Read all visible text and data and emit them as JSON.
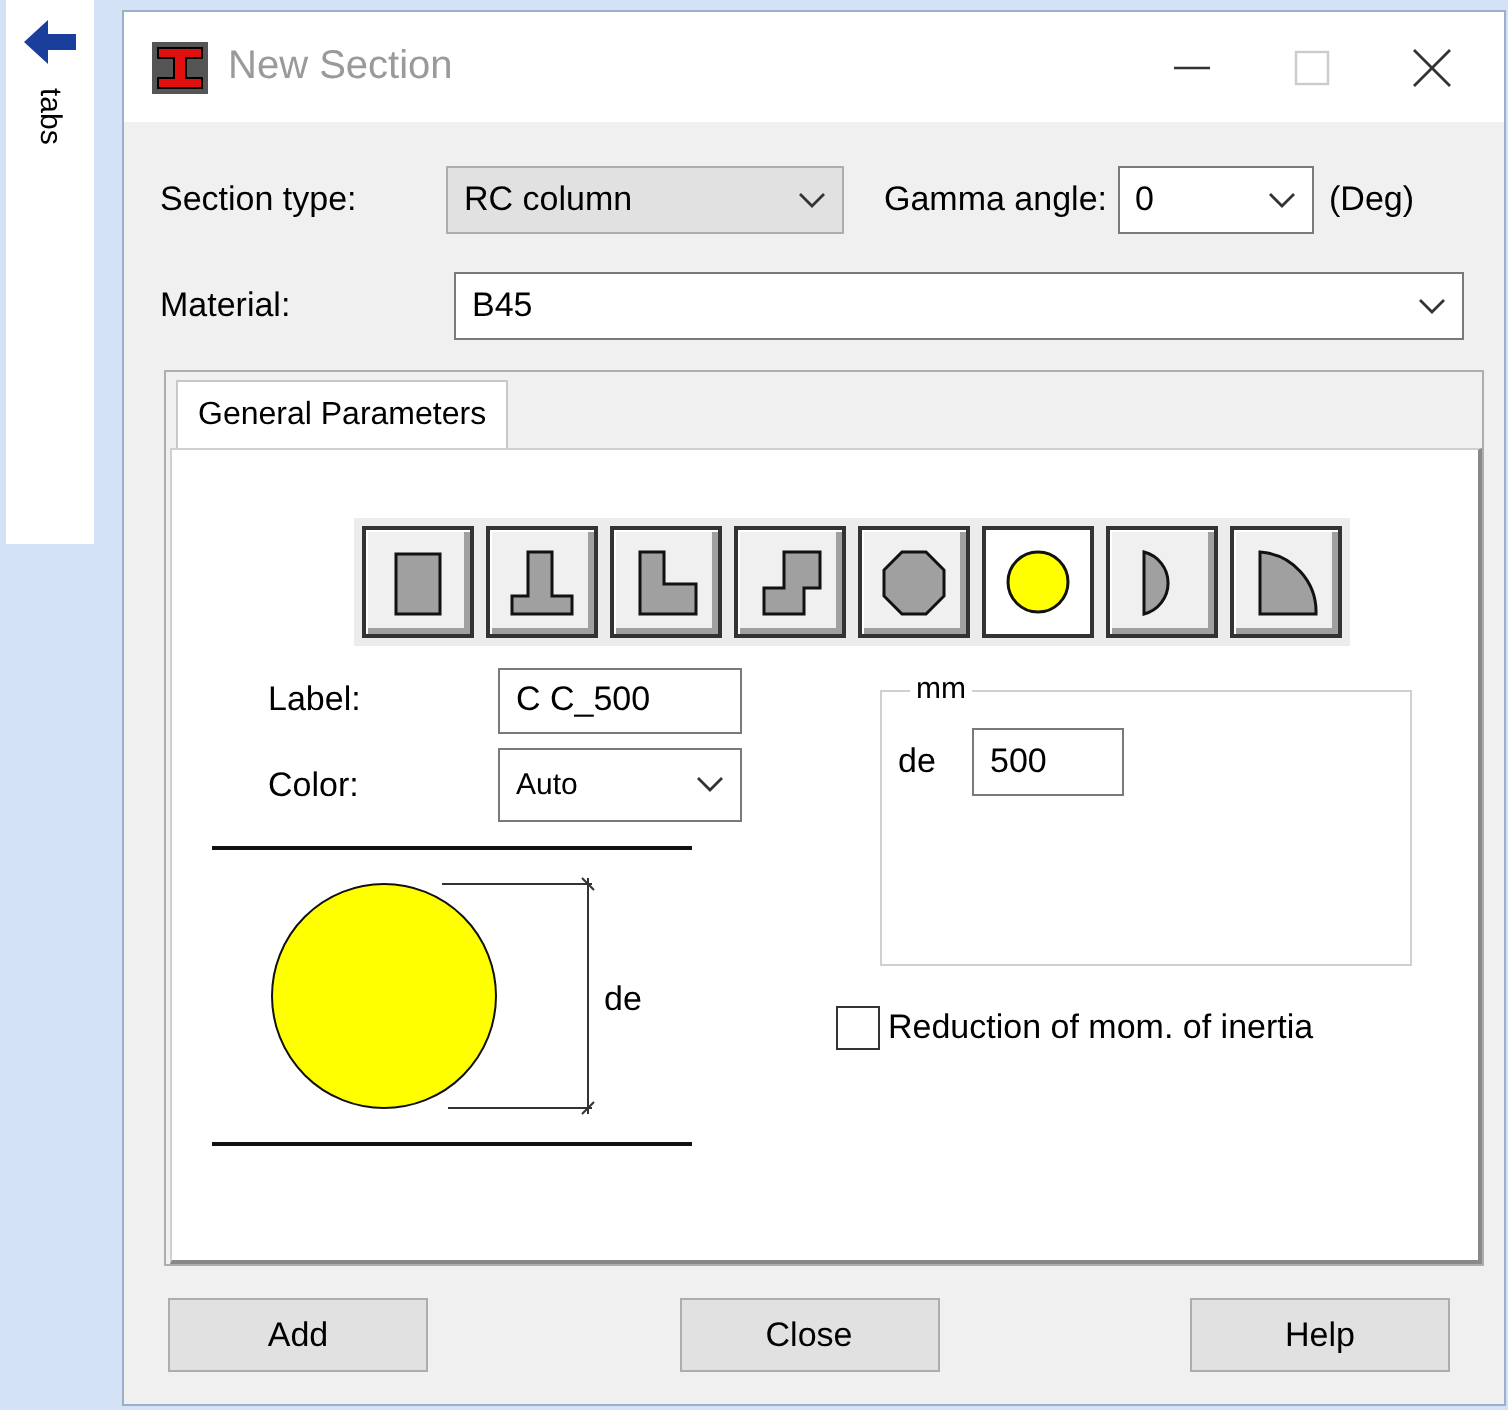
{
  "sidebar": {
    "label": "tabs"
  },
  "window": {
    "title": "New Section"
  },
  "section_type": {
    "label": "Section type:",
    "value": "RC column",
    "disabled": true
  },
  "gamma_angle": {
    "label": "Gamma angle:",
    "value": "0",
    "unit": "(Deg)"
  },
  "material": {
    "label": "Material:",
    "value": "B45"
  },
  "tabs": [
    {
      "label": "General Parameters",
      "selected": true
    }
  ],
  "shapes": [
    {
      "kind": "rectangle",
      "selected": false
    },
    {
      "kind": "tee",
      "selected": false
    },
    {
      "kind": "ell",
      "selected": false
    },
    {
      "kind": "zee",
      "selected": false
    },
    {
      "kind": "octagon",
      "selected": false
    },
    {
      "kind": "circle",
      "selected": true
    },
    {
      "kind": "half-circle",
      "selected": false
    },
    {
      "kind": "quarter-circle",
      "selected": false
    }
  ],
  "label_field": {
    "label": "Label:",
    "value": "C C_500"
  },
  "color_field": {
    "label": "Color:",
    "value": "Auto"
  },
  "diagram": {
    "dimension": "de"
  },
  "dimensions": {
    "title": "mm",
    "fields": [
      {
        "label": "de",
        "value": "500"
      }
    ]
  },
  "reduction": {
    "label": "Reduction of mom. of inertia",
    "checked": false
  },
  "buttons": [
    "Add",
    "Close",
    "Help"
  ]
}
